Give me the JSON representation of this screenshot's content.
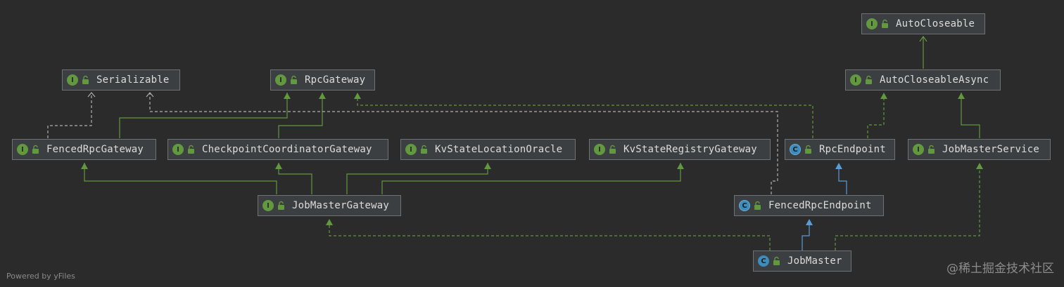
{
  "nodes": [
    {
      "id": "autocloseable",
      "label": "AutoCloseable",
      "kind": "interface"
    },
    {
      "id": "serializable",
      "label": "Serializable",
      "kind": "interface"
    },
    {
      "id": "rpcgateway",
      "label": "RpcGateway",
      "kind": "interface"
    },
    {
      "id": "autocloseableasync",
      "label": "AutoCloseableAsync",
      "kind": "interface"
    },
    {
      "id": "fencedrpcgateway",
      "label": "FencedRpcGateway",
      "kind": "interface"
    },
    {
      "id": "checkpointcoordinatorgateway",
      "label": "CheckpointCoordinatorGateway",
      "kind": "interface"
    },
    {
      "id": "kvstatelocationoracle",
      "label": "KvStateLocationOracle",
      "kind": "interface"
    },
    {
      "id": "kvstateregistrygateway",
      "label": "KvStateRegistryGateway",
      "kind": "interface"
    },
    {
      "id": "rpcendpoint",
      "label": "RpcEndpoint",
      "kind": "abstract-class"
    },
    {
      "id": "jobmasterservice",
      "label": "JobMasterService",
      "kind": "interface"
    },
    {
      "id": "jobmastergateway",
      "label": "JobMasterGateway",
      "kind": "interface"
    },
    {
      "id": "fencedrpcendpoint",
      "label": "FencedRpcEndpoint",
      "kind": "abstract-class"
    },
    {
      "id": "jobmaster",
      "label": "JobMaster",
      "kind": "class"
    }
  ],
  "edges": [
    {
      "from": "autocloseableasync",
      "to": "autocloseable",
      "type": "extends"
    },
    {
      "from": "fencedrpcgateway",
      "to": "serializable",
      "type": "extends"
    },
    {
      "from": "fencedrpcgateway",
      "to": "rpcgateway",
      "type": "extends"
    },
    {
      "from": "checkpointcoordinatorgateway",
      "to": "rpcgateway",
      "type": "extends"
    },
    {
      "from": "rpcendpoint",
      "to": "rpcgateway",
      "type": "implements"
    },
    {
      "from": "rpcendpoint",
      "to": "autocloseableasync",
      "type": "implements"
    },
    {
      "from": "jobmasterservice",
      "to": "autocloseableasync",
      "type": "extends"
    },
    {
      "from": "jobmastergateway",
      "to": "fencedrpcgateway",
      "type": "extends"
    },
    {
      "from": "jobmastergateway",
      "to": "checkpointcoordinatorgateway",
      "type": "extends"
    },
    {
      "from": "jobmastergateway",
      "to": "kvstatelocationoracle",
      "type": "extends"
    },
    {
      "from": "jobmastergateway",
      "to": "kvstateregistrygateway",
      "type": "extends"
    },
    {
      "from": "fencedrpcendpoint",
      "to": "rpcendpoint",
      "type": "class-extends"
    },
    {
      "from": "fencedrpcendpoint",
      "to": "serializable",
      "type": "implements"
    },
    {
      "from": "jobmaster",
      "to": "fencedrpcendpoint",
      "type": "class-extends"
    },
    {
      "from": "jobmaster",
      "to": "jobmastergateway",
      "type": "implements"
    },
    {
      "from": "jobmaster",
      "to": "jobmasterservice",
      "type": "implements"
    }
  ],
  "colors": {
    "background": "#2b2b2b",
    "node_fill": "#3c3f41",
    "node_border": "#6f7173",
    "node_text": "#dcdcdc",
    "interface_edge": "#62983e",
    "class_edge": "#5a9bd5",
    "serializable_edge": "#b0b0b0"
  },
  "badges": {
    "interface": "I",
    "class": "C"
  },
  "footer": "Powered by yFiles",
  "watermark": "@稀土掘金技术社区"
}
